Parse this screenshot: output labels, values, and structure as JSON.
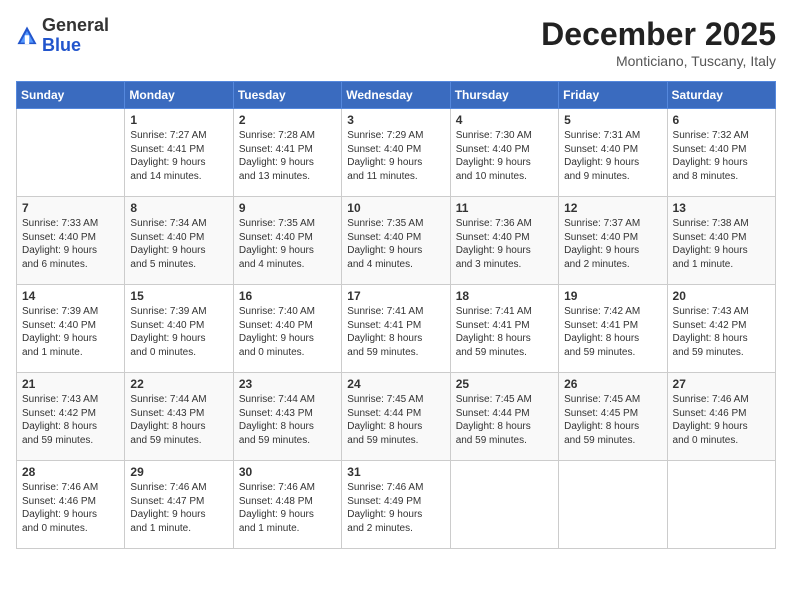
{
  "header": {
    "logo_general": "General",
    "logo_blue": "Blue",
    "month_year": "December 2025",
    "location": "Monticiano, Tuscany, Italy"
  },
  "days_of_week": [
    "Sunday",
    "Monday",
    "Tuesday",
    "Wednesday",
    "Thursday",
    "Friday",
    "Saturday"
  ],
  "weeks": [
    [
      {
        "day": "",
        "content": ""
      },
      {
        "day": "1",
        "content": "Sunrise: 7:27 AM\nSunset: 4:41 PM\nDaylight: 9 hours\nand 14 minutes."
      },
      {
        "day": "2",
        "content": "Sunrise: 7:28 AM\nSunset: 4:41 PM\nDaylight: 9 hours\nand 13 minutes."
      },
      {
        "day": "3",
        "content": "Sunrise: 7:29 AM\nSunset: 4:40 PM\nDaylight: 9 hours\nand 11 minutes."
      },
      {
        "day": "4",
        "content": "Sunrise: 7:30 AM\nSunset: 4:40 PM\nDaylight: 9 hours\nand 10 minutes."
      },
      {
        "day": "5",
        "content": "Sunrise: 7:31 AM\nSunset: 4:40 PM\nDaylight: 9 hours\nand 9 minutes."
      },
      {
        "day": "6",
        "content": "Sunrise: 7:32 AM\nSunset: 4:40 PM\nDaylight: 9 hours\nand 8 minutes."
      }
    ],
    [
      {
        "day": "7",
        "content": "Sunrise: 7:33 AM\nSunset: 4:40 PM\nDaylight: 9 hours\nand 6 minutes."
      },
      {
        "day": "8",
        "content": "Sunrise: 7:34 AM\nSunset: 4:40 PM\nDaylight: 9 hours\nand 5 minutes."
      },
      {
        "day": "9",
        "content": "Sunrise: 7:35 AM\nSunset: 4:40 PM\nDaylight: 9 hours\nand 4 minutes."
      },
      {
        "day": "10",
        "content": "Sunrise: 7:35 AM\nSunset: 4:40 PM\nDaylight: 9 hours\nand 4 minutes."
      },
      {
        "day": "11",
        "content": "Sunrise: 7:36 AM\nSunset: 4:40 PM\nDaylight: 9 hours\nand 3 minutes."
      },
      {
        "day": "12",
        "content": "Sunrise: 7:37 AM\nSunset: 4:40 PM\nDaylight: 9 hours\nand 2 minutes."
      },
      {
        "day": "13",
        "content": "Sunrise: 7:38 AM\nSunset: 4:40 PM\nDaylight: 9 hours\nand 1 minute."
      }
    ],
    [
      {
        "day": "14",
        "content": "Sunrise: 7:39 AM\nSunset: 4:40 PM\nDaylight: 9 hours\nand 1 minute."
      },
      {
        "day": "15",
        "content": "Sunrise: 7:39 AM\nSunset: 4:40 PM\nDaylight: 9 hours\nand 0 minutes."
      },
      {
        "day": "16",
        "content": "Sunrise: 7:40 AM\nSunset: 4:40 PM\nDaylight: 9 hours\nand 0 minutes."
      },
      {
        "day": "17",
        "content": "Sunrise: 7:41 AM\nSunset: 4:41 PM\nDaylight: 8 hours\nand 59 minutes."
      },
      {
        "day": "18",
        "content": "Sunrise: 7:41 AM\nSunset: 4:41 PM\nDaylight: 8 hours\nand 59 minutes."
      },
      {
        "day": "19",
        "content": "Sunrise: 7:42 AM\nSunset: 4:41 PM\nDaylight: 8 hours\nand 59 minutes."
      },
      {
        "day": "20",
        "content": "Sunrise: 7:43 AM\nSunset: 4:42 PM\nDaylight: 8 hours\nand 59 minutes."
      }
    ],
    [
      {
        "day": "21",
        "content": "Sunrise: 7:43 AM\nSunset: 4:42 PM\nDaylight: 8 hours\nand 59 minutes."
      },
      {
        "day": "22",
        "content": "Sunrise: 7:44 AM\nSunset: 4:43 PM\nDaylight: 8 hours\nand 59 minutes."
      },
      {
        "day": "23",
        "content": "Sunrise: 7:44 AM\nSunset: 4:43 PM\nDaylight: 8 hours\nand 59 minutes."
      },
      {
        "day": "24",
        "content": "Sunrise: 7:45 AM\nSunset: 4:44 PM\nDaylight: 8 hours\nand 59 minutes."
      },
      {
        "day": "25",
        "content": "Sunrise: 7:45 AM\nSunset: 4:44 PM\nDaylight: 8 hours\nand 59 minutes."
      },
      {
        "day": "26",
        "content": "Sunrise: 7:45 AM\nSunset: 4:45 PM\nDaylight: 8 hours\nand 59 minutes."
      },
      {
        "day": "27",
        "content": "Sunrise: 7:46 AM\nSunset: 4:46 PM\nDaylight: 9 hours\nand 0 minutes."
      }
    ],
    [
      {
        "day": "28",
        "content": "Sunrise: 7:46 AM\nSunset: 4:46 PM\nDaylight: 9 hours\nand 0 minutes."
      },
      {
        "day": "29",
        "content": "Sunrise: 7:46 AM\nSunset: 4:47 PM\nDaylight: 9 hours\nand 1 minute."
      },
      {
        "day": "30",
        "content": "Sunrise: 7:46 AM\nSunset: 4:48 PM\nDaylight: 9 hours\nand 1 minute."
      },
      {
        "day": "31",
        "content": "Sunrise: 7:46 AM\nSunset: 4:49 PM\nDaylight: 9 hours\nand 2 minutes."
      },
      {
        "day": "",
        "content": ""
      },
      {
        "day": "",
        "content": ""
      },
      {
        "day": "",
        "content": ""
      }
    ]
  ]
}
